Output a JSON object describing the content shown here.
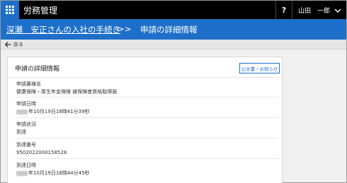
{
  "header": {
    "app_title": "労務管理",
    "help_label": "?",
    "user_name": "山田　一郎"
  },
  "titlebar": {
    "breadcrumb_link": "深瀬　安正さんの入社の手続き",
    "separator": ">>",
    "current": "申請の詳細情報"
  },
  "back": {
    "label": "戻る"
  },
  "card": {
    "title": "申請の詳細情報",
    "notice_button": "公文書・お知らせ",
    "fields": [
      {
        "label": "申請書様名",
        "value": "健康保険・厚生年金保険 被保険者資格取得届"
      },
      {
        "label": "申請日時",
        "value": "年10月19日18時41分39秒"
      },
      {
        "label": "申請状況",
        "value": "到達"
      },
      {
        "label": "到達番号",
        "value": "9502022000158528"
      },
      {
        "label": "到達日時",
        "value": "年10月19日18時44分45秒"
      }
    ]
  },
  "icons": {
    "apps": "apps-grid-icon",
    "user_menu": "chevron-down-icon",
    "back": "arrow-left-icon"
  },
  "colors": {
    "topbar": "#000000",
    "accent": "#1e6fc9",
    "background": "#f0f0f0"
  }
}
